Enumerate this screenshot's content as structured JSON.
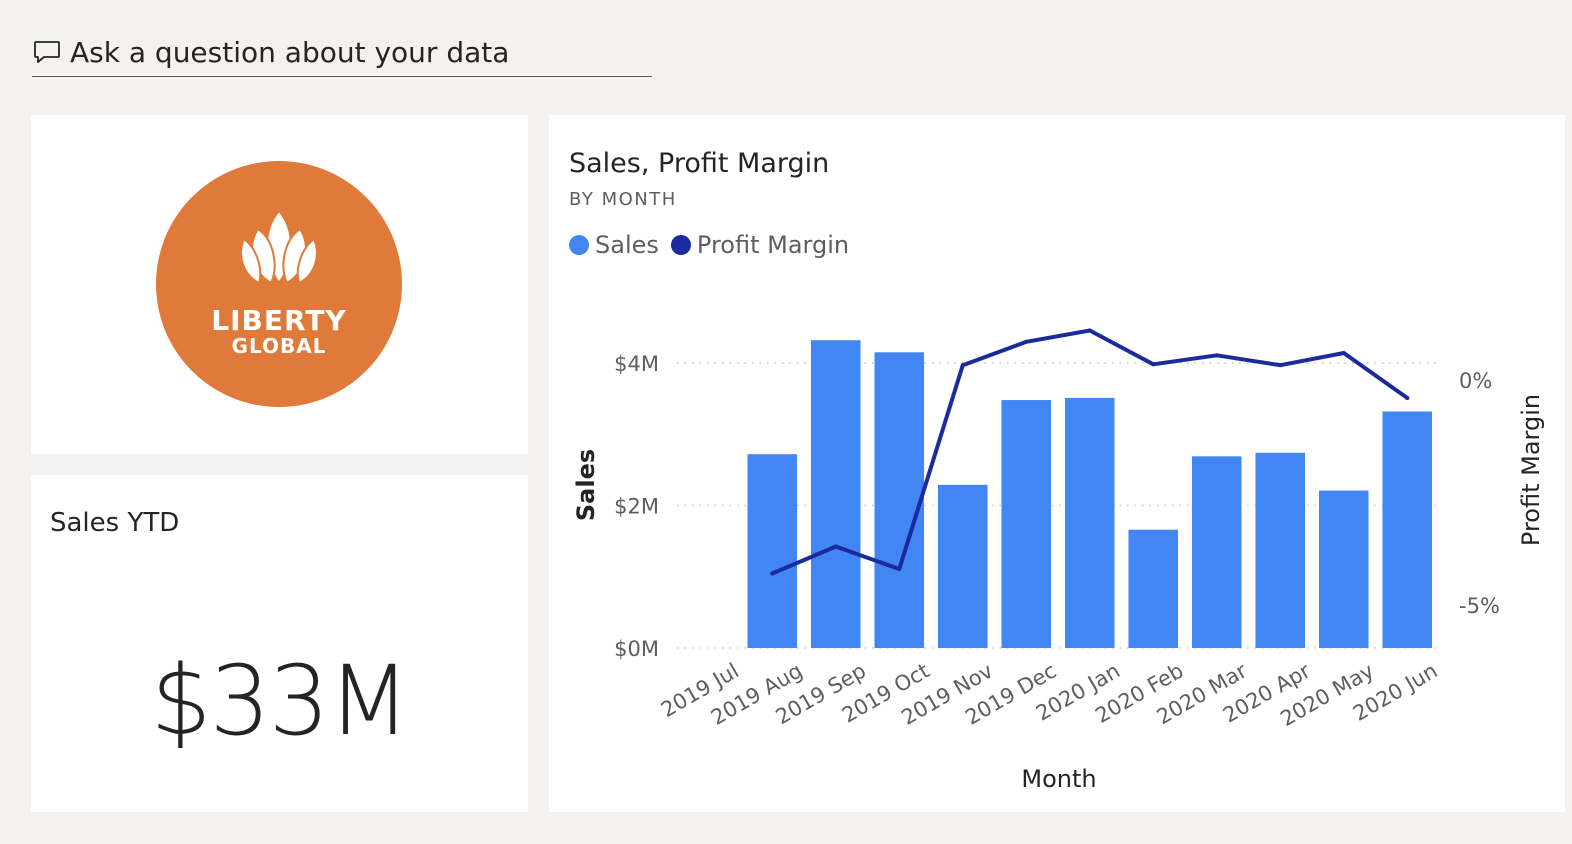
{
  "qa": {
    "icon": "speech-bubble-icon",
    "placeholder": "Ask a question about your data"
  },
  "logo": {
    "name": "LIBERTY",
    "subname": "GLOBAL",
    "icon": "liberty-global-flame-logo",
    "color": "#e07a3a"
  },
  "kpi": {
    "title": "Sales YTD",
    "value": "$33M"
  },
  "chart": {
    "title": "Sales, Profit Margin",
    "subtitle": "BY MONTH",
    "legend": [
      {
        "name": "Sales",
        "color": "#4286f4"
      },
      {
        "name": "Profit Margin",
        "color": "#1b2a9c"
      }
    ]
  },
  "chart_data": {
    "type": "bar",
    "title": "Sales, Profit Margin",
    "subtitle": "BY MONTH",
    "xlabel": "Month",
    "ylabel": "Sales",
    "y2label": "Profit Margin",
    "categories": [
      "2019 Jul",
      "2019 Aug",
      "2019 Sep",
      "2019 Oct",
      "2019 Nov",
      "2019 Dec",
      "2020 Jan",
      "2020 Feb",
      "2020 Mar",
      "2020 Apr",
      "2020 May",
      "2020 Jun"
    ],
    "ylim": [
      0,
      4
    ],
    "yticks": [
      "$0M",
      "$2M",
      "$4M"
    ],
    "y2lim": [
      -6,
      0.4
    ],
    "y2ticks": [
      "0%",
      "-5%"
    ],
    "grid": true,
    "legend_position": "top-left",
    "series": [
      {
        "name": "Sales",
        "type": "bar",
        "axis": "left",
        "unit": "$M",
        "color": "#4286f4",
        "values": [
          null,
          2.72,
          4.32,
          4.15,
          2.29,
          3.48,
          3.51,
          1.66,
          2.69,
          2.74,
          2.21,
          3.32
        ]
      },
      {
        "name": "Profit Margin",
        "type": "line",
        "axis": "right",
        "unit": "%",
        "color": "#1b2a9c",
        "values": [
          null,
          -4.3,
          -3.7,
          -4.2,
          0.33,
          0.85,
          1.1,
          0.35,
          0.55,
          0.33,
          0.6,
          -0.4
        ]
      }
    ]
  }
}
